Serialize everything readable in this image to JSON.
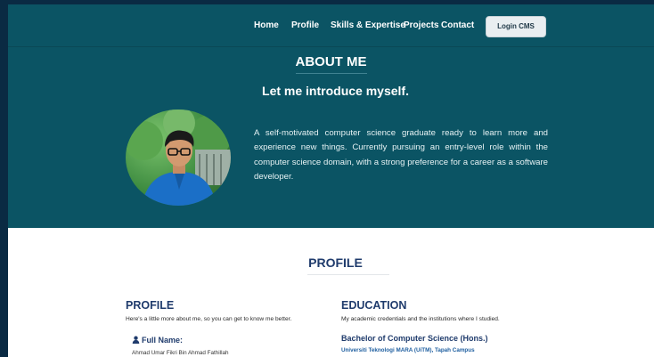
{
  "nav": {
    "items": [
      {
        "label": "Home"
      },
      {
        "label": "Profile"
      },
      {
        "label": "Skills & Expertise"
      },
      {
        "label": "Projects"
      },
      {
        "label": "Contact"
      }
    ],
    "login_label": "Login CMS"
  },
  "about": {
    "title": "ABOUT ME",
    "subtitle": "Let me introduce myself.",
    "description": "A self-motivated computer science graduate ready to learn more and experience new things. Currently pursuing an entry-level role within the computer science domain, with a strong preference for a career as a software developer."
  },
  "profile_section": {
    "title": "PROFILE",
    "profile": {
      "heading": "PROFILE",
      "subheading": "Here's a little more about me, so you can get to know me better.",
      "full_name_label": "Full Name:",
      "full_name_value": "Ahmad Umar Fikri Bin Ahmad Fathillah"
    },
    "education": {
      "heading": "EDUCATION",
      "subheading": "My academic credentials and the institutions where I studied.",
      "degree": "Bachelor of Computer Science (Hons.)",
      "school": "Universiti Teknologi MARA (UiTM), Tapah Campus"
    }
  },
  "colors": {
    "primary_teal": "#0b5464",
    "heading_navy": "#1f3b6c"
  }
}
